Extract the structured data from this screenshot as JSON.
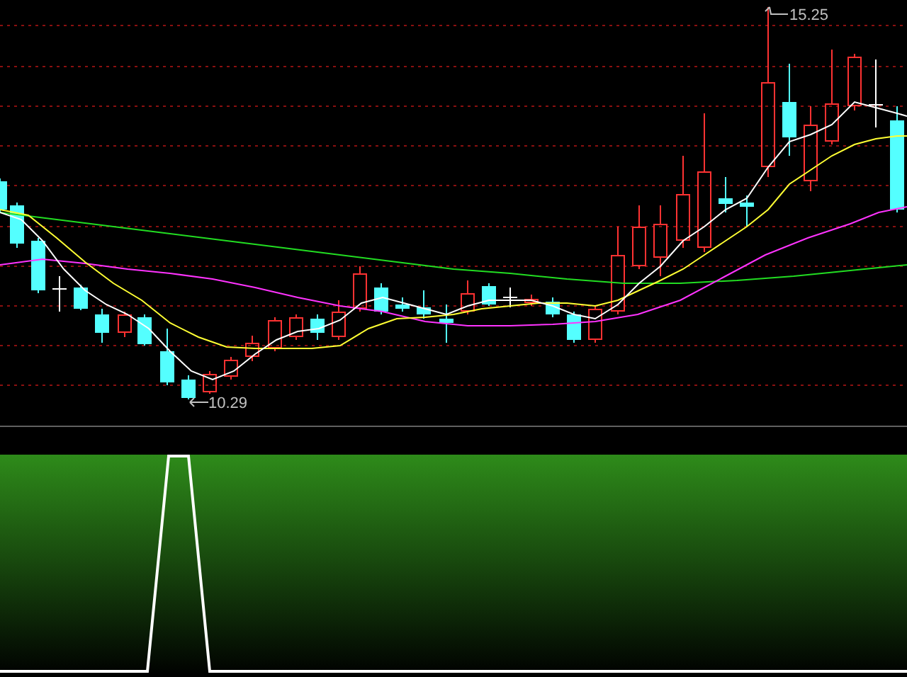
{
  "price_chart": {
    "high_label": "15.25",
    "low_label": "10.29"
  }
}
